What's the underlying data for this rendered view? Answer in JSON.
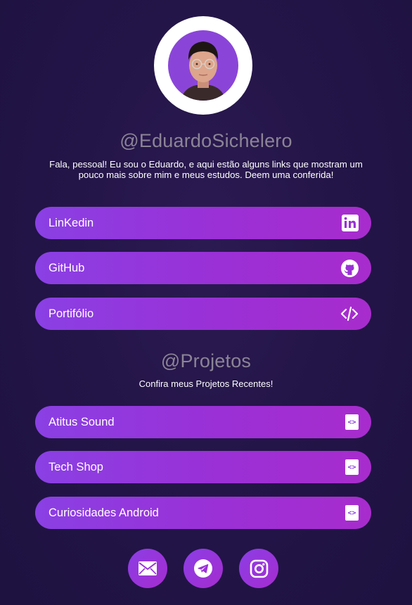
{
  "profile": {
    "handle": "@EduardoSichelero",
    "bio": "Fala, pessoal! Eu sou o Eduardo, e aqui estão alguns links que mostram um pouco mais sobre mim e meus estudos. Deem uma conferida!"
  },
  "links": [
    {
      "label": "LinKedin",
      "icon": "linkedin-icon"
    },
    {
      "label": "GitHub",
      "icon": "github-icon"
    },
    {
      "label": "Portifólio",
      "icon": "code-icon"
    }
  ],
  "projects": {
    "title": "@Projetos",
    "subtitle": "Confira meus Projetos Recentes!",
    "items": [
      {
        "label": "Atitus Sound",
        "icon": "code-file-icon"
      },
      {
        "label": "Tech Shop",
        "icon": "code-file-icon"
      },
      {
        "label": "Curiosidades Android",
        "icon": "code-file-icon"
      }
    ]
  },
  "social": [
    {
      "icon": "email-icon"
    },
    {
      "icon": "telegram-icon"
    },
    {
      "icon": "instagram-icon"
    }
  ],
  "colors": {
    "background": "#241548",
    "button_start": "#8a40e4",
    "button_end": "#a82ccd",
    "handle_text": "#8c8496"
  }
}
